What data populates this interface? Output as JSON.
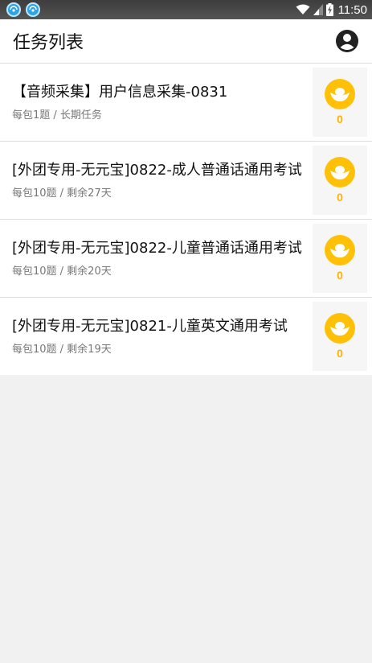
{
  "status_bar": {
    "time": "11:50"
  },
  "app_bar": {
    "title": "任务列表"
  },
  "tasks": [
    {
      "title": "【音频采集】用户信息采集-0831",
      "meta": "每包1题 / 长期任务",
      "reward": "0"
    },
    {
      "title": "[外团专用-无元宝]0822-成人普通话通用考试",
      "meta": "每包10题 / 剩余27天",
      "reward": "0"
    },
    {
      "title": "[外团专用-无元宝]0822-儿童普通话通用考试",
      "meta": "每包10题 / 剩余20天",
      "reward": "0"
    },
    {
      "title": "[外团专用-无元宝]0821-儿童英文通用考试",
      "meta": "每包10题 / 剩余19天",
      "reward": "0"
    }
  ],
  "colors": {
    "accent": "#ffc107",
    "reward_text": "#ffb300",
    "notif_icon": "#2ea4e6"
  }
}
